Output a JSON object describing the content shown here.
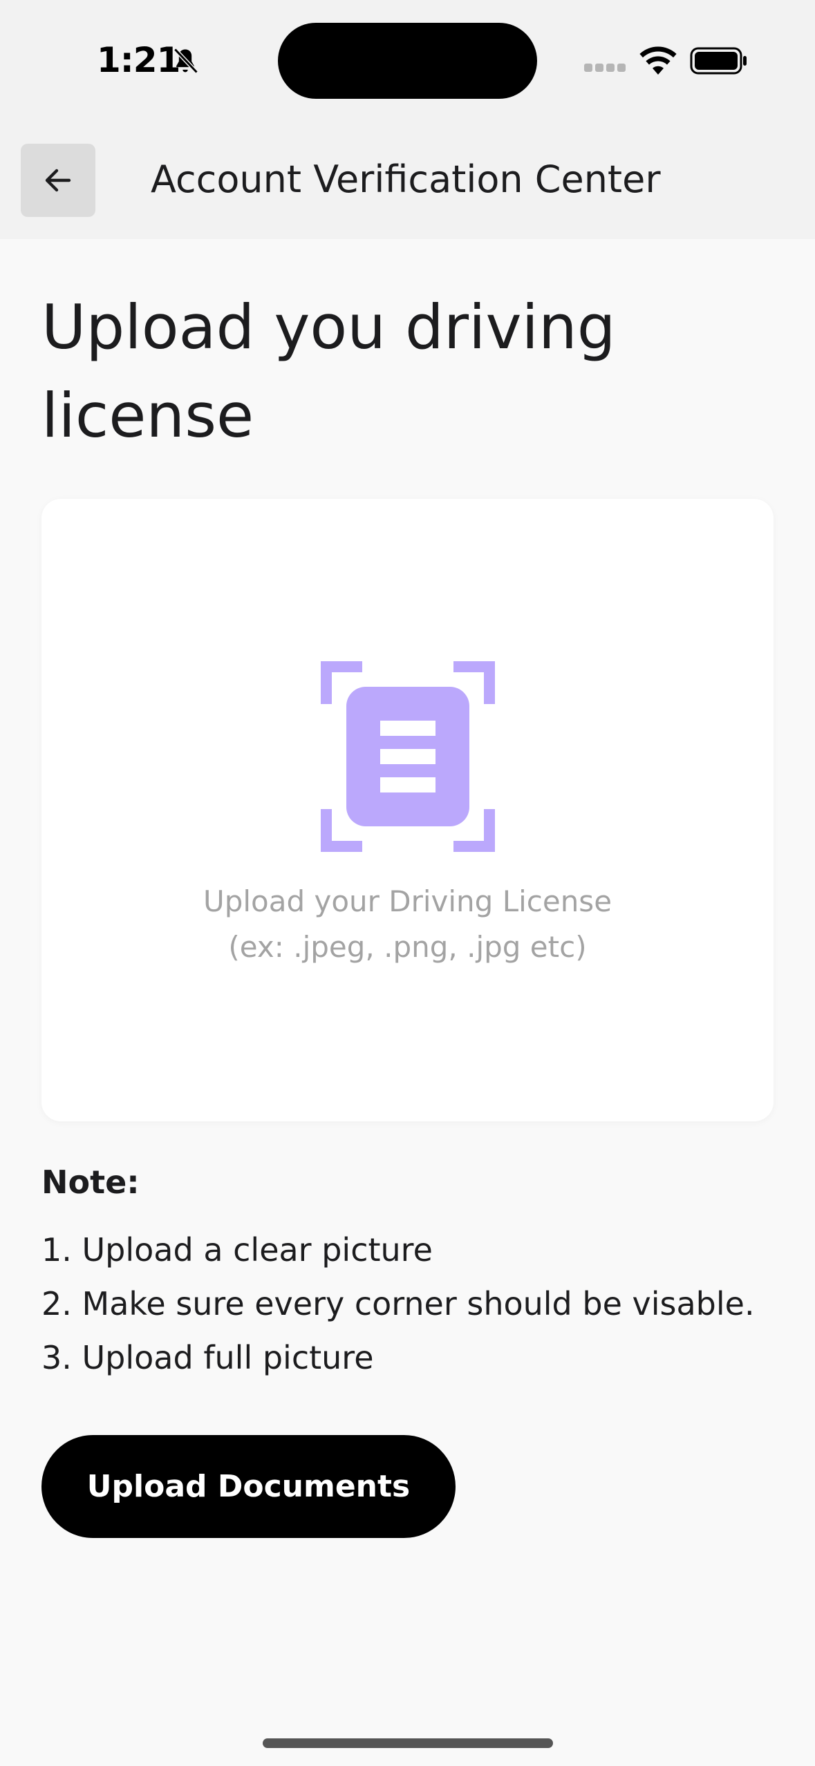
{
  "status_bar": {
    "time": "1:21"
  },
  "header": {
    "title": "Account Verification Center"
  },
  "main": {
    "title": "Upload you driving license",
    "upload_card": {
      "hint_line1": "Upload your Driving License",
      "hint_line2": "(ex: .jpeg, .png, .jpg etc)",
      "icon": "document-scan-icon",
      "icon_color": "#bba8fc"
    },
    "note": {
      "title": "Note:",
      "items": [
        "1. Upload a clear picture",
        "2. Make sure every corner should be visable.",
        "3. Upload full picture"
      ]
    },
    "upload_button_label": "Upload Documents"
  }
}
